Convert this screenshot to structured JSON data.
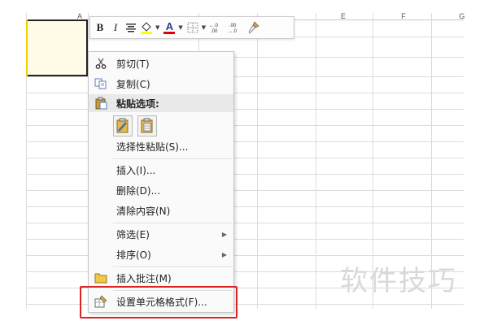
{
  "spreadsheet": {
    "column_headers": [
      "A",
      "E",
      "F",
      "G"
    ]
  },
  "mini_toolbar": {
    "bold": "B",
    "italic": "I",
    "font_color": "A",
    "decimal_increase": "+.0 .00",
    "decimal_decrease": ".00 ⇒.0",
    "fill_color": "#ffff00",
    "font_color_accent": "#e00000"
  },
  "context_menu": {
    "cut": "剪切(T)",
    "copy": "复制(C)",
    "paste_options": "粘贴选项:",
    "paste_special": "选择性粘贴(S)...",
    "insert": "插入(I)...",
    "delete": "删除(D)...",
    "clear_contents": "清除内容(N)",
    "filter": "筛选(E)",
    "sort": "排序(O)",
    "insert_comment": "插入批注(M)",
    "format_cells": "设置单元格格式(F)..."
  },
  "watermark": "软件技巧",
  "colors": {
    "highlight_border": "#dd2222",
    "selection_border": "#222222"
  }
}
